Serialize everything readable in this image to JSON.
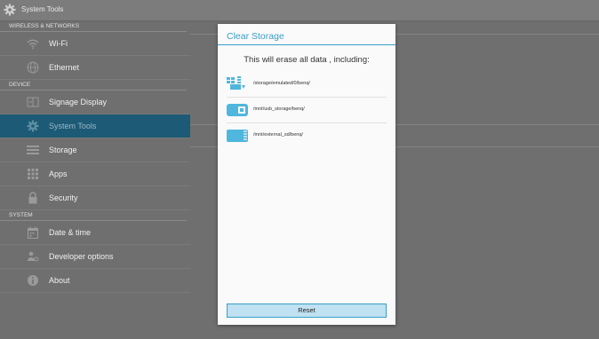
{
  "app": {
    "title": "System Tools"
  },
  "sidebar": {
    "sections": [
      {
        "label": "WIRELESS & NETWORKS",
        "items": [
          {
            "label": "Wi-Fi",
            "icon": "wifi-icon"
          },
          {
            "label": "Ethernet",
            "icon": "ethernet-icon"
          }
        ]
      },
      {
        "label": "DEVICE",
        "items": [
          {
            "label": "Signage Display",
            "icon": "display-icon"
          },
          {
            "label": "System Tools",
            "icon": "gear-icon",
            "selected": true
          },
          {
            "label": "Storage",
            "icon": "storage-icon"
          },
          {
            "label": "Apps",
            "icon": "apps-icon"
          },
          {
            "label": "Security",
            "icon": "lock-icon"
          }
        ]
      },
      {
        "label": "SYSTEM",
        "items": [
          {
            "label": "Date & time",
            "icon": "calendar-icon"
          },
          {
            "label": "Developer options",
            "icon": "developer-icon"
          },
          {
            "label": "About",
            "icon": "info-icon"
          }
        ]
      }
    ]
  },
  "dialog": {
    "title": "Clear Storage",
    "message": "This will erase all data , including:",
    "paths": [
      {
        "label": "/storage/emulated/0/benq/",
        "icon": "internal-storage-icon"
      },
      {
        "label": "/mnt/usb_storage/benq/",
        "icon": "usb-storage-icon"
      },
      {
        "label": "/mnt/external_sd/benq/",
        "icon": "sd-card-icon"
      }
    ],
    "reset_label": "Reset"
  },
  "colors": {
    "accent": "#3a9fc9",
    "selected_bg": "#1c5a75",
    "background": "#6f6f6f",
    "dialog_bg": "#fafafa",
    "button_bg": "#bfe1f1"
  }
}
